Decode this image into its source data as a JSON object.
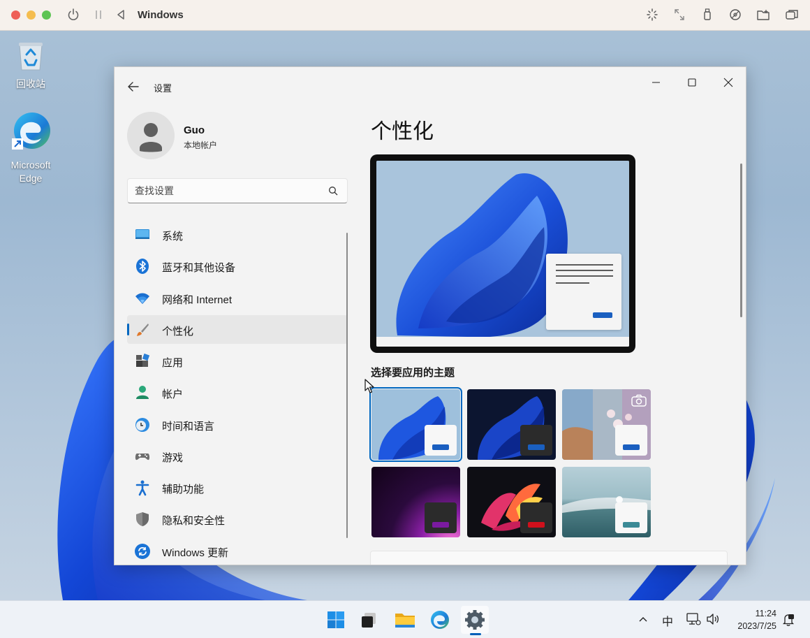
{
  "host": {
    "title": "Windows"
  },
  "desktop": {
    "icons": [
      {
        "label": "回收站"
      },
      {
        "label": "Microsoft Edge"
      }
    ]
  },
  "settings": {
    "title": "设置",
    "user": {
      "name": "Guo",
      "account_type": "本地帐户"
    },
    "search": {
      "placeholder": "查找设置"
    },
    "nav": [
      {
        "label": "系统",
        "icon": "monitor-icon"
      },
      {
        "label": "蓝牙和其他设备",
        "icon": "bluetooth-icon"
      },
      {
        "label": "网络和 Internet",
        "icon": "wifi-icon"
      },
      {
        "label": "个性化",
        "icon": "brush-icon",
        "selected": true
      },
      {
        "label": "应用",
        "icon": "apps-icon"
      },
      {
        "label": "帐户",
        "icon": "person-icon"
      },
      {
        "label": "时间和语言",
        "icon": "clock-globe-icon"
      },
      {
        "label": "游戏",
        "icon": "gamepad-icon"
      },
      {
        "label": "辅助功能",
        "icon": "accessibility-icon"
      },
      {
        "label": "隐私和安全性",
        "icon": "shield-icon"
      },
      {
        "label": "Windows 更新",
        "icon": "update-icon"
      }
    ],
    "page_title": "个性化",
    "themes_title": "选择要应用的主题",
    "themes": [
      {
        "name": "light-bloom",
        "selected": true
      },
      {
        "name": "dark-bloom"
      },
      {
        "name": "spotlight"
      },
      {
        "name": "glow"
      },
      {
        "name": "captured-motion"
      },
      {
        "name": "flow"
      }
    ]
  },
  "taskbar": {
    "apps": [
      "start-icon",
      "task-view-icon",
      "file-explorer-icon",
      "edge-icon",
      "settings-icon"
    ],
    "tray": {
      "ime": "中"
    },
    "clock": {
      "time": "11:24",
      "date": "2023/7/25"
    }
  },
  "colors": {
    "accent": "#0067c0",
    "window_bg": "#f3f3f3",
    "bloom": "#1f4fd8"
  }
}
